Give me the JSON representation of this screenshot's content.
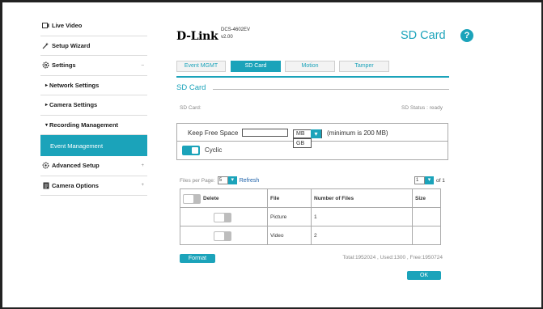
{
  "sidebar": {
    "items": [
      {
        "label": "Live Video",
        "icon": "video-icon"
      },
      {
        "label": "Setup Wizard",
        "icon": "wand-icon"
      },
      {
        "label": "Settings",
        "icon": "gear-icon",
        "arrow": "–"
      },
      {
        "label": "Network Settings"
      },
      {
        "label": "Camera Settings"
      },
      {
        "label": "Recording Management"
      },
      {
        "label": "Event Management"
      },
      {
        "label": "Advanced Setup",
        "icon": "advanced-icon",
        "arrow": "+"
      },
      {
        "label": "Camera Options",
        "icon": "options-icon",
        "arrow": "+"
      }
    ]
  },
  "header": {
    "logo": "D-Link",
    "model": "DCS-4602EV",
    "version": "v2.00",
    "page_title": "SD Card",
    "help_icon": "?"
  },
  "tabs": [
    "Event MGMT",
    "SD Card",
    "Motion",
    "Tamper"
  ],
  "section": {
    "title": "SD Card",
    "sd_label": "SD Card:",
    "sd_status": "SD Status : ready"
  },
  "free_space": {
    "label": "Keep Free Space",
    "value": "",
    "unit_selected": "MB",
    "unit_option_open": "GB",
    "hint": "(minimum is 200 MB)",
    "cyclic_label": "Cyclic",
    "cyclic_on": true
  },
  "list_controls": {
    "files_per_page_label": "Files per Page:",
    "files_per_page": "5",
    "refresh": "Refresh",
    "page": "1",
    "of_pages": "of 1"
  },
  "table": {
    "headers": [
      "Delete",
      "File",
      "Number of Files",
      "Size"
    ],
    "rows": [
      {
        "file": "Picture",
        "count": "1",
        "size": ""
      },
      {
        "file": "Video",
        "count": "2",
        "size": ""
      }
    ]
  },
  "footer": {
    "format_button": "Format",
    "totals": "Total:1952024 , Used:1300 , Free:1950724",
    "ok_button": "OK"
  },
  "colors": {
    "accent": "#1ba3ba",
    "link": "#1b5fa8"
  }
}
